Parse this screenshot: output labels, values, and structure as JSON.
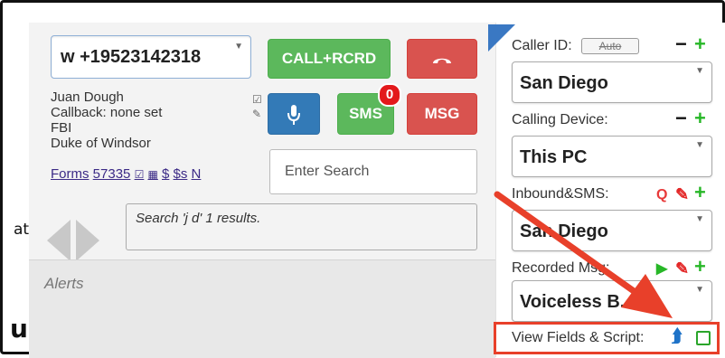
{
  "dialer": {
    "phone_value": "w +19523142318",
    "call_record_label": "CALL+RCRD",
    "sms_label": "SMS",
    "sms_badge": "0",
    "msg_label": "MSG",
    "contact_lines": [
      "Juan Dough",
      "Callback: none set",
      "FBI",
      "Duke of Windsor"
    ],
    "links": [
      "Forms",
      "57335",
      "☑",
      "▦",
      "$",
      "$s",
      "N"
    ],
    "search_placeholder": "Enter Search",
    "search_results": "Search 'j d' 1 results.",
    "alerts_label": "Alerts"
  },
  "page_fragments": {
    "left_text": "at",
    "bottom_text": "u"
  },
  "settings": {
    "caller_id_label": "Caller ID:",
    "auto_label": "Auto",
    "caller_id_value": "San Diego",
    "calling_device_label": "Calling Device:",
    "calling_device_value": "This PC",
    "inbound_label": "Inbound&SMS:",
    "inbound_q": "Q",
    "inbound_value": "San Diego",
    "recorded_msg_label": "Recorded Msg:",
    "recorded_msg_value": "Voiceless B...",
    "view_fields_label": "View Fields & Script:"
  },
  "colors": {
    "green": "#5cb85c",
    "red": "#d9534f",
    "blue": "#337ab7",
    "annotation": "#e8402a"
  },
  "icons": [
    "hangup-icon",
    "microphone-icon",
    "check-icon",
    "pencil-icon",
    "left-arrow-icon",
    "right-arrow-icon",
    "play-icon",
    "pencil-icon",
    "plus-icon",
    "minus-icon",
    "scroll-up-icon"
  ]
}
